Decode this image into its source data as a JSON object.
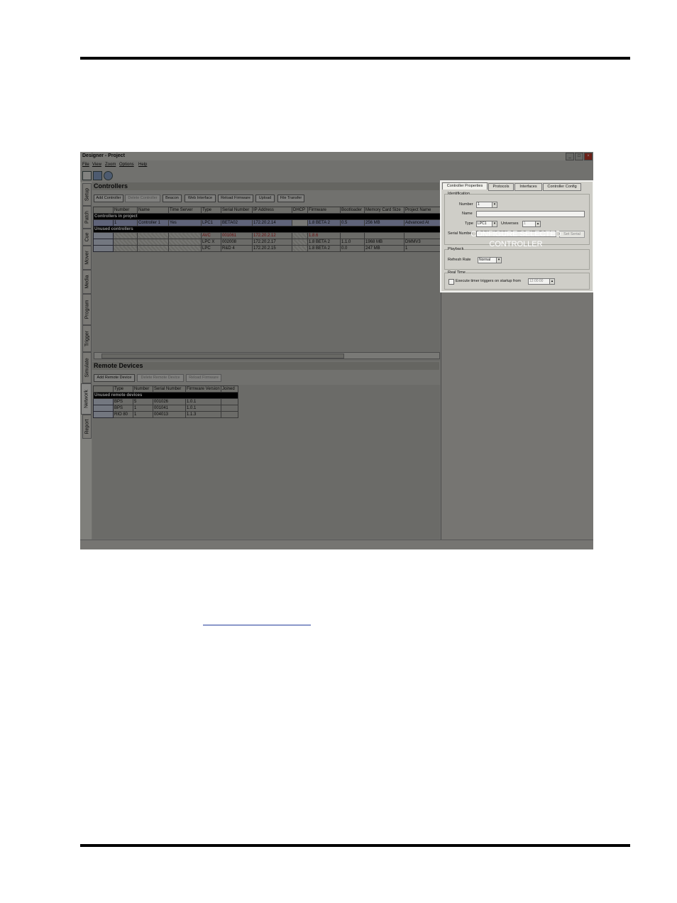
{
  "window": {
    "title": "Designer - Project",
    "menu": [
      "File",
      "View",
      "Zoom",
      "Options",
      "Help"
    ],
    "controls": [
      "_",
      "□",
      "×"
    ]
  },
  "vertical_tabs": [
    "Setup",
    "Patch",
    "Cue",
    "Mover",
    "Media",
    "Program",
    "Trigger",
    "Simulate",
    "Network",
    "Report"
  ],
  "controllers": {
    "title": "Controllers",
    "buttons": [
      "Add Controller",
      "Delete Controller",
      "Beacon",
      "Web Interface",
      "Reload Firmware",
      "Upload",
      "File Transfer"
    ],
    "columns": [
      "",
      "Number",
      "Name",
      "Time Server",
      "Type",
      "Serial Number",
      "IP Address",
      "DHCP",
      "Firmware",
      "Bootloader",
      "Memory Card Size",
      "Project Name"
    ],
    "section_in_project": "Controllers in project",
    "section_unused": "Unused controllers",
    "in_project_rows": [
      [
        "",
        "1",
        "Controller 1",
        "Yes",
        "LPC1",
        "BETA02",
        "172.20.2.14",
        "",
        "1.8 BETA 2",
        "0.5",
        "256 MB",
        "Advanced At"
      ]
    ],
    "unused_rows": [
      [
        "",
        "",
        "",
        "",
        "AVC",
        "001061",
        "172.20.2.12",
        "",
        "1.8.6",
        "",
        "",
        ""
      ],
      [
        "",
        "",
        "",
        "",
        "LPC X",
        "002008",
        "172.20.2.17",
        "",
        "1.8 BETA 2",
        "1.1.0",
        "1968 MB",
        "DMMV3"
      ],
      [
        "",
        "",
        "",
        "",
        "LPC",
        "R&D 4",
        "172.20.2.15",
        "",
        "1.8 BETA 2",
        "0.0",
        "247 MB",
        "1"
      ]
    ]
  },
  "remote_devices": {
    "title": "Remote Devices",
    "buttons": [
      "Add Remote Device",
      "Delete Remote Device",
      "Reload Firmware"
    ],
    "columns": [
      "",
      "Type",
      "Number",
      "Serial Number",
      "Firmware Version",
      "Joined"
    ],
    "section_unused": "Unused remote devices",
    "rows": [
      [
        "",
        "BPS",
        "5",
        "001026",
        "1.0.1",
        ""
      ],
      [
        "",
        "BPS",
        "1",
        "001041",
        "1.0.1",
        ""
      ],
      [
        "",
        "RIO 80",
        "1",
        "004013",
        "1.1.3",
        ""
      ]
    ]
  },
  "properties": {
    "tabs": [
      "Controller Properties",
      "Protocols",
      "Interfaces",
      "Controller Config"
    ],
    "identification": {
      "legend": "Identification",
      "number_label": "Number",
      "number_value": "1",
      "name_label": "Name",
      "name_value": "",
      "type_label": "Type",
      "type_value": "LPC1",
      "universes_label": "Universes",
      "universes_value": "1",
      "serial_label": "Serial Number",
      "set_serial_button": "Set Serial"
    },
    "playback": {
      "legend": "Playback",
      "refresh_label": "Refresh Rate",
      "refresh_value": "Normal"
    },
    "real_time": {
      "legend": "Real Time",
      "execute_label": "Execute timer triggers on startup from",
      "time_value": "12:00:00"
    }
  },
  "callout": {
    "line1": "CONFIGURE SELECTED",
    "line2": "CONTROLLER"
  }
}
